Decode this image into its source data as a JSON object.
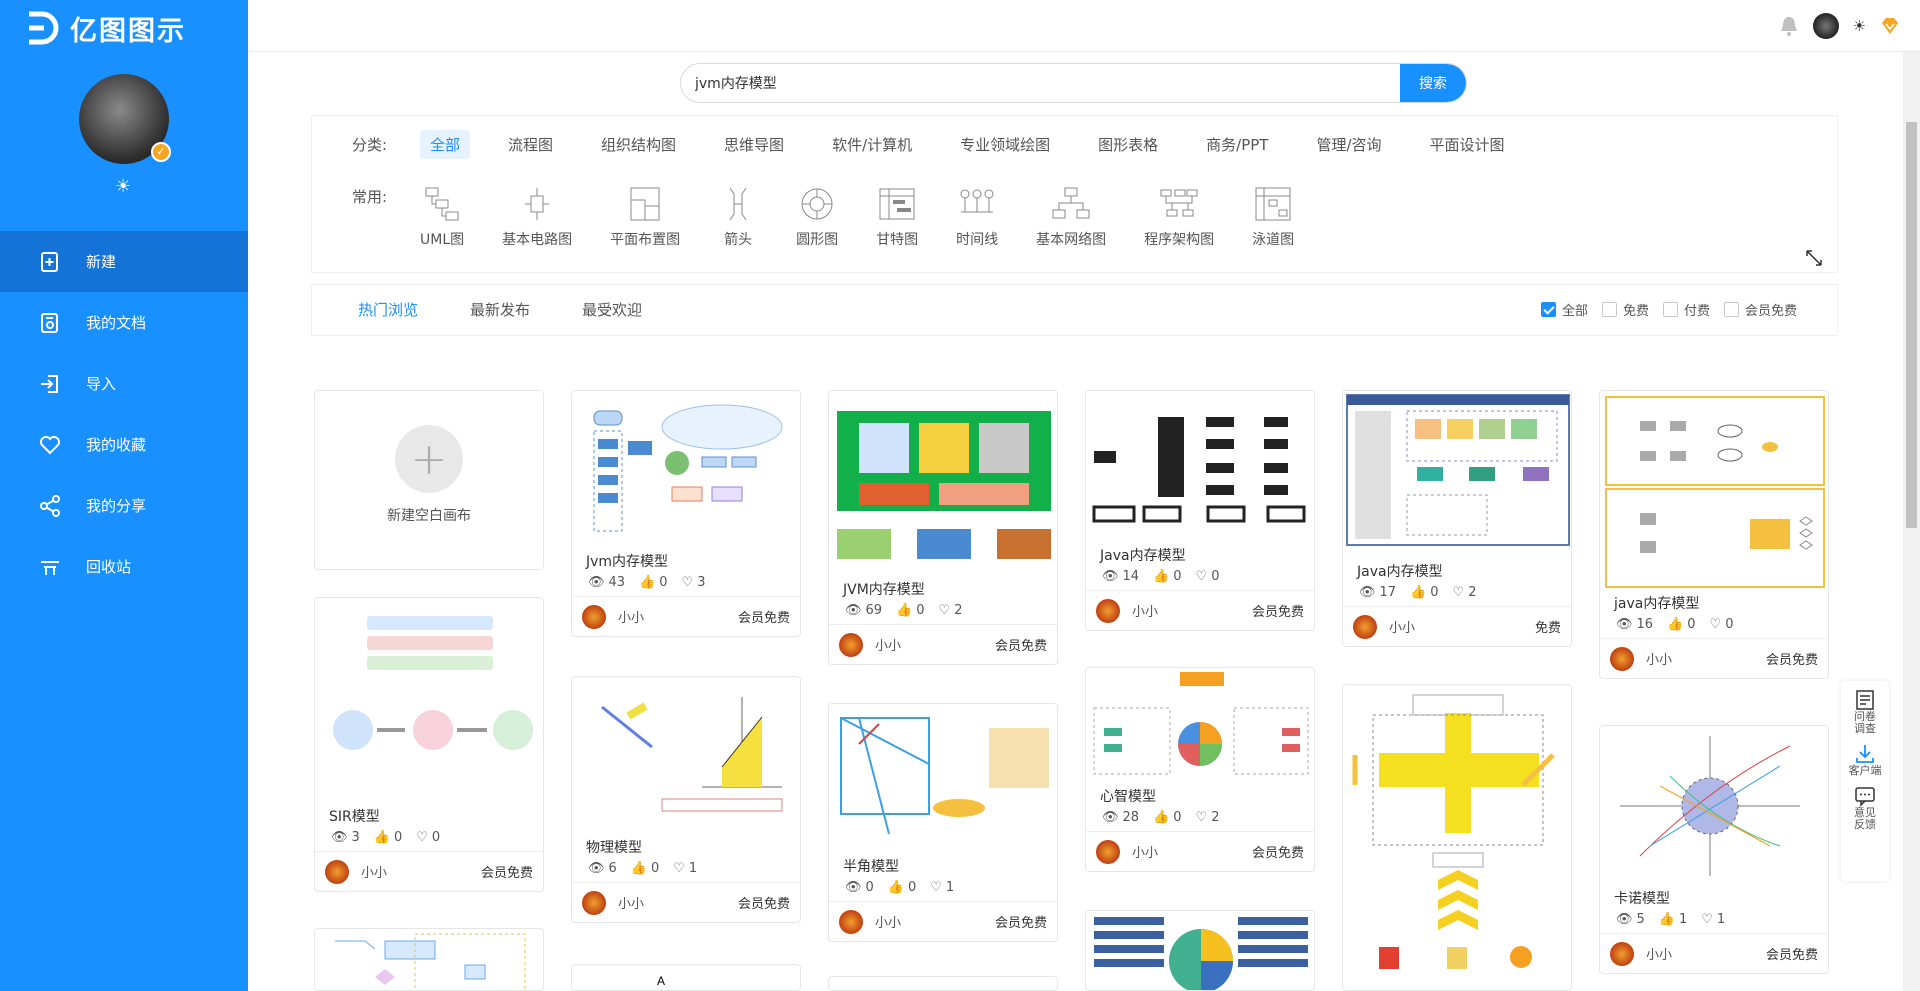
{
  "app": {
    "name": "亿图图示"
  },
  "sidebar": {
    "items": [
      {
        "label": "新建",
        "icon": "new-doc-icon"
      },
      {
        "label": "我的文档",
        "icon": "document-icon"
      },
      {
        "label": "导入",
        "icon": "import-icon"
      },
      {
        "label": "我的收藏",
        "icon": "heart-icon"
      },
      {
        "label": "我的分享",
        "icon": "share-icon"
      },
      {
        "label": "回收站",
        "icon": "trash-icon"
      }
    ]
  },
  "search": {
    "value": "jvm内存模型",
    "button": "搜索"
  },
  "categories": {
    "title": "分类:",
    "items": [
      "全部",
      "流程图",
      "组织结构图",
      "思维导图",
      "软件/计算机",
      "专业领域绘图",
      "图形表格",
      "商务/PPT",
      "管理/咨询",
      "平面设计图"
    ],
    "active": "全部"
  },
  "common": {
    "title": "常用:",
    "items": [
      "UML图",
      "基本电路图",
      "平面布置图",
      "箭头",
      "圆形图",
      "甘特图",
      "时间线",
      "基本网络图",
      "程序架构图",
      "泳道图"
    ]
  },
  "tabs": {
    "items": [
      "热门浏览",
      "最新发布",
      "最受欢迎"
    ],
    "active": "热门浏览"
  },
  "filters": [
    {
      "label": "全部",
      "checked": true
    },
    {
      "label": "免费",
      "checked": false
    },
    {
      "label": "付费",
      "checked": false
    },
    {
      "label": "会员免费",
      "checked": false
    }
  ],
  "new_canvas": {
    "label": "新建空白画布"
  },
  "cards": [
    {
      "title": "SIR模型",
      "views": "3",
      "likes": "0",
      "favs": "0",
      "author": "小小",
      "price": "会员免费"
    },
    {
      "title": "Jvm内存模型",
      "views": "43",
      "likes": "0",
      "favs": "3",
      "author": "小小",
      "price": "会员免费"
    },
    {
      "title": "物理模型",
      "views": "6",
      "likes": "0",
      "favs": "1",
      "author": "小小",
      "price": "会员免费"
    },
    {
      "title": "JVM内存模型",
      "views": "69",
      "likes": "0",
      "favs": "2",
      "author": "小小",
      "price": "会员免费"
    },
    {
      "title": "半角模型",
      "views": "0",
      "likes": "0",
      "favs": "1",
      "author": "小小",
      "price": "会员免费"
    },
    {
      "title": "Java内存模型",
      "views": "14",
      "likes": "0",
      "favs": "0",
      "author": "小小",
      "price": "会员免费"
    },
    {
      "title": "心智模型",
      "views": "28",
      "likes": "0",
      "favs": "2",
      "author": "小小",
      "price": "会员免费"
    },
    {
      "title": "Java内存模型",
      "views": "17",
      "likes": "0",
      "favs": "2",
      "author": "小小",
      "price": "免费"
    },
    {
      "title": "java内存模型",
      "views": "16",
      "likes": "0",
      "favs": "0",
      "author": "小小",
      "price": "会员免费"
    },
    {
      "title": "卡诺模型",
      "views": "5",
      "likes": "1",
      "favs": "1",
      "author": "小小",
      "price": "会员免费"
    }
  ],
  "float_bar": [
    {
      "label": "问卷调查",
      "icon": "survey-icon"
    },
    {
      "label": "客户端",
      "icon": "download-icon"
    },
    {
      "label": "意见反馈",
      "icon": "feedback-icon"
    }
  ],
  "colors": {
    "primary": "#1890ff",
    "sidebar_active": "#1473d6"
  }
}
